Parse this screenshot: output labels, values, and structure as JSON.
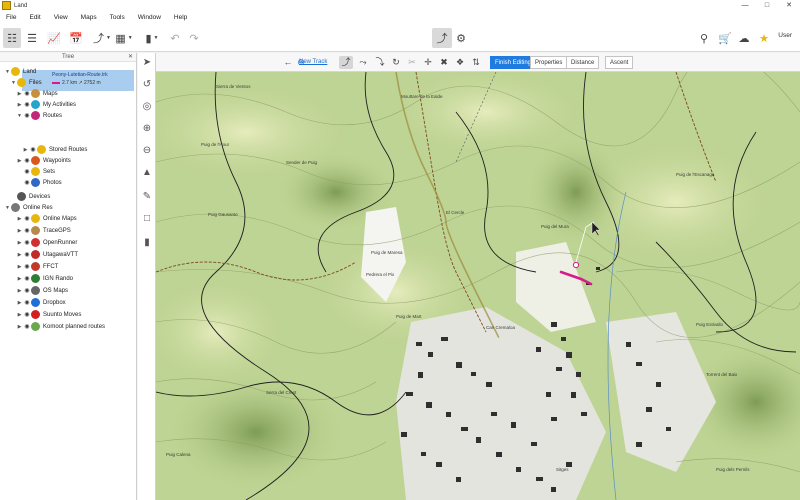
{
  "window": {
    "title": "Land"
  },
  "menu": [
    "File",
    "Edit",
    "View",
    "Maps",
    "Tools",
    "Window",
    "Help"
  ],
  "user": {
    "label": "User"
  },
  "tree": {
    "header": "Tree",
    "items": [
      {
        "label": "Land",
        "icon": "land-icon",
        "color": "#e8b70c"
      },
      {
        "label": "Files",
        "icon": "folder-icon",
        "color": "#e8b70c"
      },
      {
        "label": "Maps",
        "icon": "maps-icon",
        "color": "#c98f3a"
      },
      {
        "label": "My Activities",
        "icon": "activities-icon",
        "color": "#26a4c9"
      },
      {
        "label": "Routes",
        "icon": "routes-icon",
        "color": "#c4267a"
      },
      {
        "label": "Stored Routes",
        "icon": "stored-routes-icon",
        "color": "#e8b70c"
      },
      {
        "label": "Waypoints",
        "icon": "waypoints-icon",
        "color": "#d9591d"
      },
      {
        "label": "Sets",
        "icon": "sets-icon",
        "color": "#e8b70c"
      },
      {
        "label": "Photos",
        "icon": "photos-icon",
        "color": "#2f69c4"
      },
      {
        "label": "Devices",
        "icon": "devices-icon",
        "color": "#555555"
      },
      {
        "label": "Online Res",
        "icon": "online-res-icon",
        "color": "#777777"
      },
      {
        "label": "Online Maps",
        "icon": "online-maps-icon",
        "color": "#e8b70c"
      },
      {
        "label": "TraceGPS",
        "icon": "tracegps-icon",
        "color": "#b68a4b"
      },
      {
        "label": "OpenRunner",
        "icon": "openrunner-icon",
        "color": "#d03030"
      },
      {
        "label": "UtagawaVTT",
        "icon": "utagawavtt-icon",
        "color": "#c22a2a"
      },
      {
        "label": "FFCT",
        "icon": "ffct-icon",
        "color": "#c0392b"
      },
      {
        "label": "IGN Rando",
        "icon": "ign-rando-icon",
        "color": "#2e7d32"
      },
      {
        "label": "OS Maps",
        "icon": "os-maps-icon",
        "color": "#666666"
      },
      {
        "label": "Dropbox",
        "icon": "dropbox-icon",
        "color": "#1f6fd6"
      },
      {
        "label": "Suunto Moves",
        "icon": "suunto-icon",
        "color": "#d21f1f"
      },
      {
        "label": "Komoot planned routes",
        "icon": "komoot-icon",
        "color": "#6aa84f"
      }
    ],
    "selected": {
      "name": "Peony-Lutetian-Route.trk",
      "meta": "2.7 km ↗ 2752 m"
    }
  },
  "editbar": {
    "new_track": "New Track",
    "tabs": [
      "Finish Editing",
      "Properties",
      "Distance",
      "Ascent"
    ]
  },
  "map": {
    "labels": [
      "Sierra de Vientos",
      "Mouttare de la Ealde",
      "Puig de l'Hour",
      "Sender de Puig",
      "Puig Gausante",
      "El Cercle",
      "Puig de Maresa",
      "Puig de l'Escanaga",
      "Pedrera el Pix",
      "Puig del Mura",
      "Can Cremaloa",
      "Puig de Mart",
      "Puig Estivallo",
      "Torrent del Baix",
      "Serra del Crest",
      "Puig Calena",
      "Sitges",
      "Puig dels Pernils"
    ]
  }
}
